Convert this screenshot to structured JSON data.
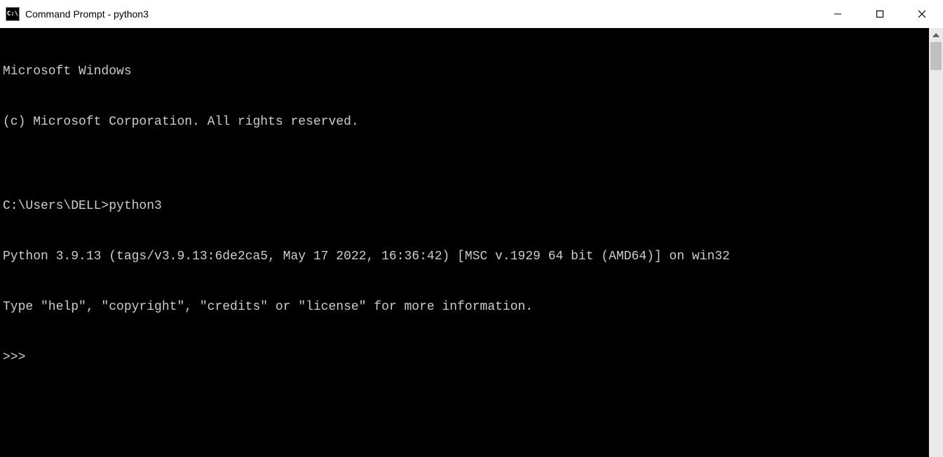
{
  "window": {
    "title": "Command Prompt - python3",
    "icon_label": "C:\\"
  },
  "terminal": {
    "lines": [
      "Microsoft Windows",
      "(c) Microsoft Corporation. All rights reserved.",
      "",
      "C:\\Users\\DELL>python3",
      "Python 3.9.13 (tags/v3.9.13:6de2ca5, May 17 2022, 16:36:42) [MSC v.1929 64 bit (AMD64)] on win32",
      "Type \"help\", \"copyright\", \"credits\" or \"license\" for more information.",
      ">>>"
    ]
  }
}
